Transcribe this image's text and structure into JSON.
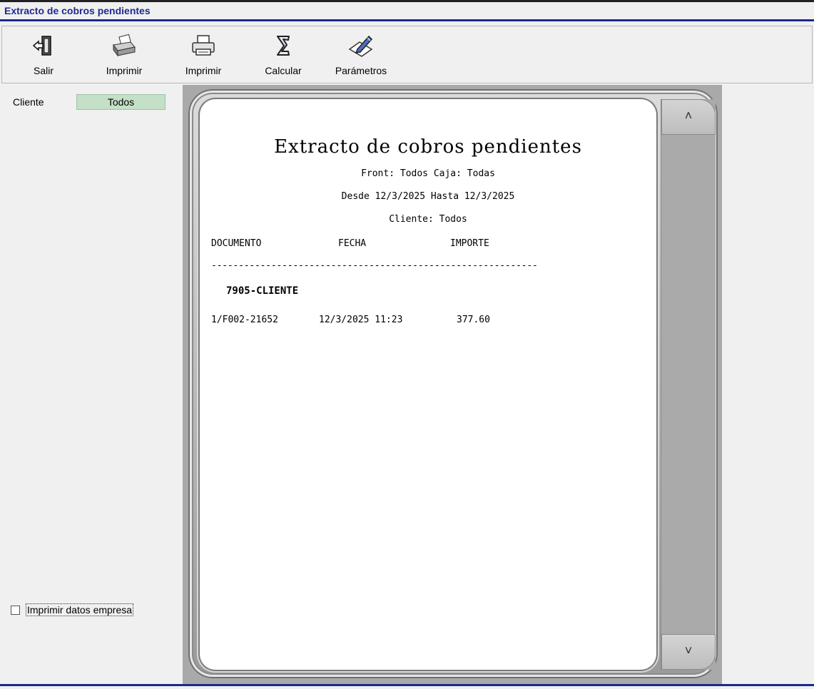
{
  "window": {
    "title": "Extracto de cobros pendientes"
  },
  "toolbar": {
    "buttons": [
      {
        "id": "salir",
        "label": "Salir",
        "icon": "exit-door-icon"
      },
      {
        "id": "imprimir1",
        "label": "Imprimir",
        "icon": "fax-printer-icon"
      },
      {
        "id": "imprimir2",
        "label": "Imprimir",
        "icon": "printer-icon"
      },
      {
        "id": "calcular",
        "label": "Calcular",
        "icon": "sigma-icon"
      },
      {
        "id": "parametros",
        "label": "Parámetros",
        "icon": "pen-paper-icon"
      }
    ]
  },
  "filters": {
    "cliente_label": "Cliente",
    "cliente_value": "Todos",
    "checkbox_label": "Imprimir datos empresa",
    "checkbox_checked": false
  },
  "report": {
    "title": "Extracto de cobros pendientes",
    "front_line": "Front: Todos Caja: Todas",
    "date_line": "Desde 12/3/2025 Hasta 12/3/2025",
    "client_line": "Cliente: Todos",
    "columns": [
      "DOCUMENTO",
      "FECHA",
      "IMPORTE"
    ],
    "separator": "------------------------------------------------------------",
    "group": "7905-CLIENTE",
    "rows": [
      {
        "documento": "1/F002-21652",
        "fecha": "12/3/2025 11:23",
        "importe": "377.60"
      }
    ]
  },
  "viewer": {
    "scroll_up": "˄",
    "scroll_down": "˅"
  },
  "colors": {
    "accent": "#1e2a8f",
    "field_bg": "#c4e0c6"
  }
}
